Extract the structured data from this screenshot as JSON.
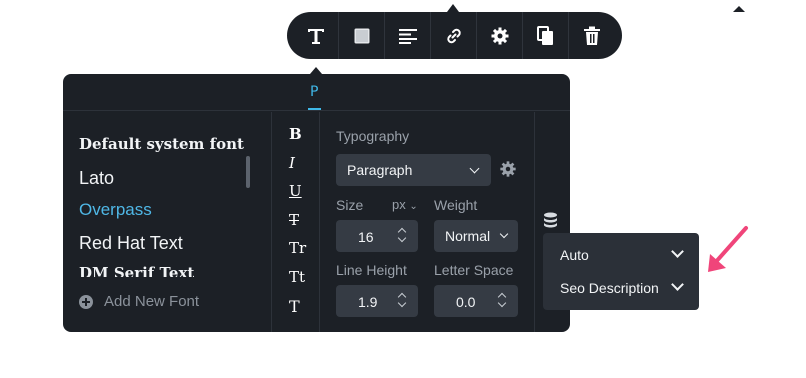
{
  "toolbar": {
    "buttons": [
      {
        "icon": "text-icon"
      },
      {
        "icon": "square-icon"
      },
      {
        "icon": "align-left-icon"
      },
      {
        "icon": "link-icon"
      },
      {
        "icon": "gear-icon"
      },
      {
        "icon": "copy-icon"
      },
      {
        "icon": "trash-icon"
      }
    ]
  },
  "panel": {
    "active_tab": "P",
    "fonts": [
      "Default system font",
      "Lato",
      "Overpass",
      "Red Hat Text",
      "DM Serif Text"
    ],
    "selected_font": "Overpass",
    "add_font_label": "Add New Font",
    "style_icons": [
      {
        "label": "B",
        "icon": "bold-icon"
      },
      {
        "label": "I",
        "icon": "italic-icon"
      },
      {
        "label": "U",
        "icon": "underline-icon"
      },
      {
        "label": "T",
        "icon": "strikethrough-icon"
      },
      {
        "label": "Tr",
        "icon": "text-transform-icon"
      },
      {
        "label": "Tt",
        "icon": "capitalize-icon"
      },
      {
        "label": "T",
        "icon": "text-icon"
      }
    ],
    "typography": {
      "title": "Typography",
      "element_select": "Paragraph",
      "size_label": "Size",
      "unit": "px",
      "weight_label": "Weight",
      "size_value": "16",
      "weight_value": "Normal",
      "line_height_label": "Line Height",
      "letter_space_label": "Letter Space",
      "line_height_value": "1.9",
      "letter_space_value": "0.0"
    }
  },
  "popover": {
    "items": [
      {
        "label": "Auto"
      },
      {
        "label": "Seo Description"
      }
    ]
  },
  "colors": {
    "panel_bg": "#1c2026",
    "accent": "#3fb8e8",
    "arrow": "#f0457a"
  }
}
